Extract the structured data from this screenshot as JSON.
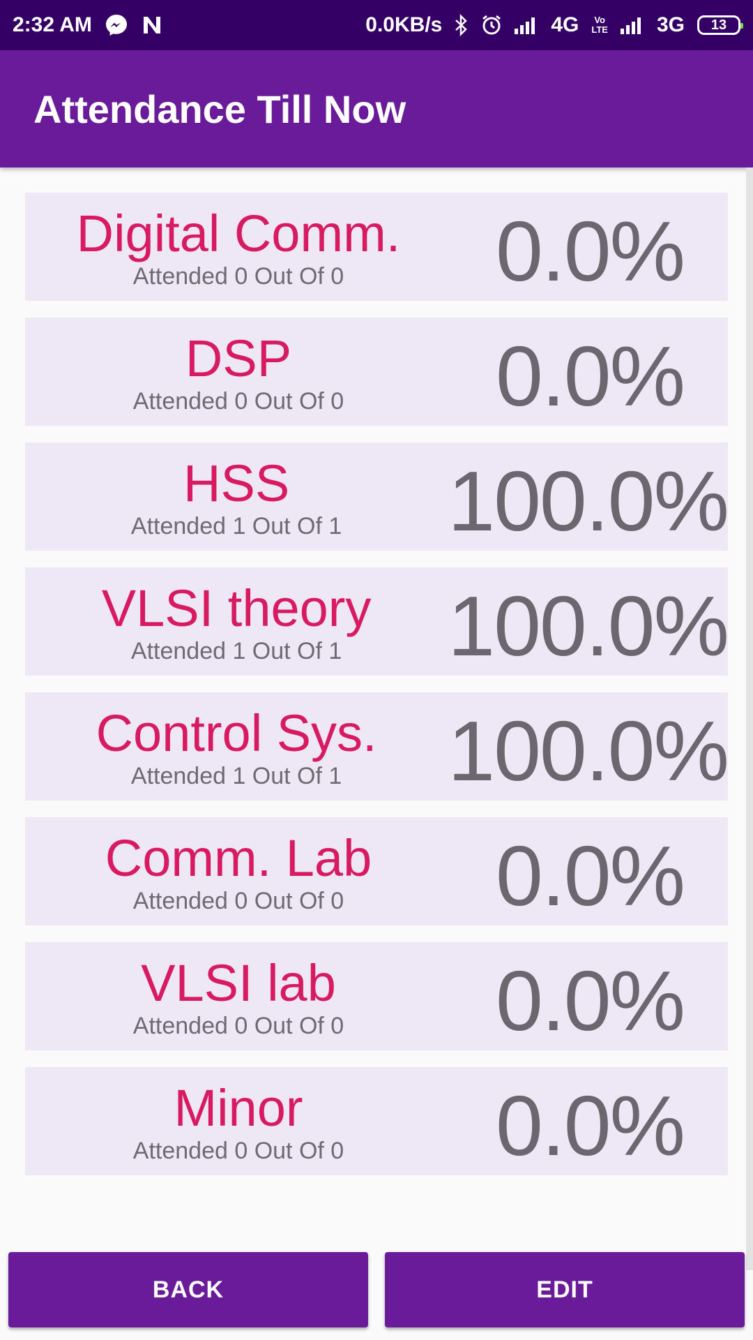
{
  "status_bar": {
    "time": "2:32 AM",
    "net_speed": "0.0KB/s",
    "network_1": "4G",
    "volte": "VoLTE",
    "network_2": "3G",
    "battery": "13"
  },
  "app_bar": {
    "title": "Attendance Till Now"
  },
  "subjects": [
    {
      "name": "Digital Comm.",
      "attended": "Attended 0 Out Of 0",
      "percent": "0.0%"
    },
    {
      "name": "DSP",
      "attended": "Attended 0 Out Of 0",
      "percent": "0.0%"
    },
    {
      "name": "HSS",
      "attended": "Attended 1 Out Of 1",
      "percent": "100.0%"
    },
    {
      "name": "VLSI theory",
      "attended": "Attended 1 Out Of 1",
      "percent": "100.0%"
    },
    {
      "name": "Control Sys.",
      "attended": "Attended 1 Out Of 1",
      "percent": "100.0%"
    },
    {
      "name": "Comm. Lab",
      "attended": "Attended 0 Out Of 0",
      "percent": "0.0%"
    },
    {
      "name": "VLSI lab",
      "attended": "Attended 0 Out Of 0",
      "percent": "0.0%"
    },
    {
      "name": "Minor",
      "attended": "Attended 0 Out Of 0",
      "percent": "0.0%"
    }
  ],
  "buttons": {
    "back": "BACK",
    "edit": "EDIT"
  },
  "colors": {
    "status_bar": "#350066",
    "primary": "#6a1b9a",
    "subject_text": "#d81b60",
    "card_bg": "#ede7f6"
  }
}
